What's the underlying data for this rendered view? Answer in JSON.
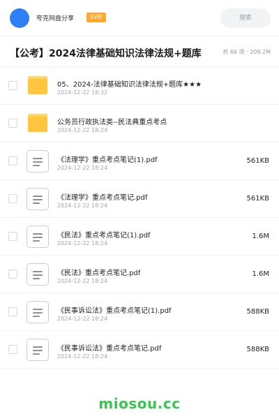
{
  "header": {
    "user_name": "夸克网盘分享",
    "badge": "SVIP",
    "search_placeholder": "搜索"
  },
  "title": "【公考】2024法律基础知识法律法规+题库",
  "meta": "共 66 项 · 209.2M",
  "items": [
    {
      "type": "folder",
      "name": "05、2024-法律基础知识法律法规+题库★★★",
      "date": "2024-12-22 18:32",
      "size": ""
    },
    {
      "type": "folder",
      "name": "公务员行政执法类--民法典重点考点",
      "date": "2024-12-22 18:24",
      "size": ""
    },
    {
      "type": "file",
      "name": "《法理学》重点考点笔记(1).pdf",
      "date": "2024-12-22 18:24",
      "size": "561KB"
    },
    {
      "type": "file",
      "name": "《法理学》重点考点笔记.pdf",
      "date": "2024-12-22 18:24",
      "size": "561KB"
    },
    {
      "type": "file",
      "name": "《民法》重点考点笔记(1).pdf",
      "date": "2024-12-22 18:24",
      "size": "1.6M"
    },
    {
      "type": "file",
      "name": "《民法》重点考点笔记.pdf",
      "date": "2024-12-22 18:24",
      "size": "1.6M"
    },
    {
      "type": "file",
      "name": "《民事诉讼法》重点考点笔记(1).pdf",
      "date": "2024-12-22 18:24",
      "size": "588KB"
    },
    {
      "type": "file",
      "name": "《民事诉讼法》重点考点笔记.pdf",
      "date": "2024-12-22 18:24",
      "size": "588KB"
    }
  ],
  "watermark": "miosou.cc",
  "colors": {
    "avatar": "#2f7ff7",
    "svip_badge": "#ffa82e",
    "folder": "#ffc53d",
    "watermark": "#38c552"
  }
}
